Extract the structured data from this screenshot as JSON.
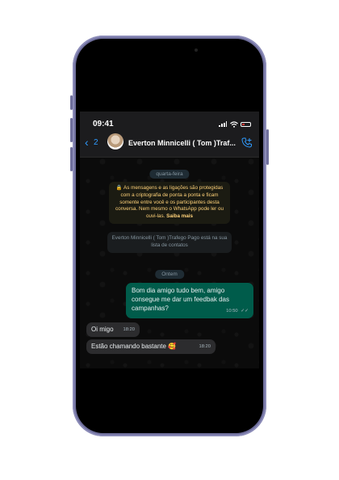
{
  "status_bar": {
    "time": "09:41"
  },
  "header": {
    "back_count": "2",
    "contact_name": "Everton Minnicelli ( Tom )Traf..."
  },
  "chat": {
    "date_chip_1": "quarta-feira",
    "encryption_notice": "🔒 As mensagens e as ligações são protegidas com a criptografia de ponta a ponta e ficam somente entre você e os participantes desta conversa. Nem mesmo o WhatsApp pode ler ou ouvi-las.",
    "encryption_link": "Saiba mais",
    "contact_notice": "Everton Minnicelli ( Tom )Trafego Pago está na sua lista de contatos",
    "date_chip_2": "Ontem",
    "messages": [
      {
        "direction": "outgoing",
        "text": "Bom dia amigo tudo bem, amigo consegue me dar um feedbak das campanhas?",
        "time": "10:50",
        "status": "read"
      },
      {
        "direction": "incoming",
        "text": "Oi migo",
        "time": "18:20"
      },
      {
        "direction": "incoming",
        "text": "Estão chamando bastante 🥰",
        "time": "18:20"
      }
    ]
  },
  "colors": {
    "outgoing_bubble": "#005c4b",
    "incoming_bubble": "#2c2c2e",
    "accent_blue": "#2f9bff",
    "encryption_text": "#ffd279",
    "phone_frame": "#6f6f9c"
  }
}
